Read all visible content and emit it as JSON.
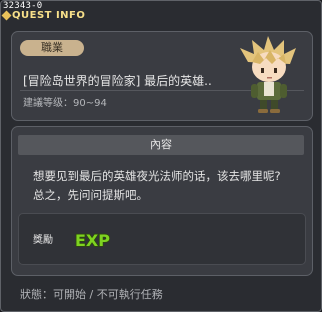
{
  "window": {
    "quest_id": "32343-0",
    "title": "QUEST INFO"
  },
  "quest": {
    "tag": "職業",
    "name": "[冒险岛世界的冒险家] 最后的英雄..",
    "level": "建議等级：90~94"
  },
  "content": {
    "header": "內容",
    "line1": "想要见到最后的英雄夜光法师的话，该去哪里呢?",
    "line2": "总之，先问问提斯吧。"
  },
  "reward": {
    "label": "獎勵",
    "exp_text": "EXP"
  },
  "status": "狀態：可開始 / 不可執行任務",
  "colors": {
    "title": "#f7e08a",
    "tag_bg": "#c9b28e",
    "exp_fill": "#7ed321"
  },
  "icons": [
    "title-diamond-icon",
    "npc-character-portrait",
    "exp-icon"
  ]
}
